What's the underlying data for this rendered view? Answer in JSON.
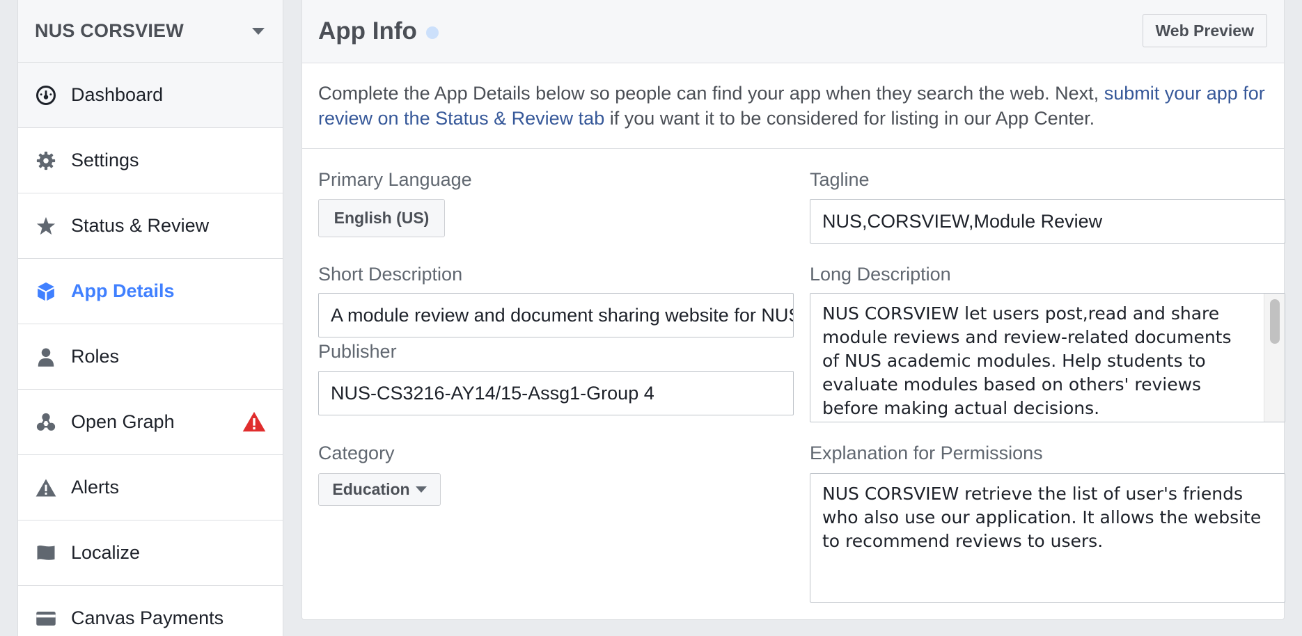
{
  "sidebar": {
    "app_name": "NUS CORSVIEW",
    "items": [
      {
        "label": "Dashboard",
        "icon": "dashboard-icon"
      },
      {
        "label": "Settings",
        "icon": "gear-icon"
      },
      {
        "label": "Status & Review",
        "icon": "star-icon"
      },
      {
        "label": "App Details",
        "icon": "cube-icon",
        "active": true
      },
      {
        "label": "Roles",
        "icon": "person-icon"
      },
      {
        "label": "Open Graph",
        "icon": "graph-nodes-icon",
        "badge": "warning-icon"
      },
      {
        "label": "Alerts",
        "icon": "alert-triangle-icon"
      },
      {
        "label": "Localize",
        "icon": "flag-icon"
      },
      {
        "label": "Canvas Payments",
        "icon": "credit-card-icon"
      }
    ]
  },
  "header": {
    "title": "App Info",
    "web_preview_label": "Web Preview"
  },
  "intro": {
    "text_before": "Complete the App Details below so people can find your app when they search the web. Next, ",
    "link_text": "submit your app for review on the Status & Review tab",
    "text_after": " if you want it to be considered for listing in our App Center."
  },
  "form": {
    "primary_language": {
      "label": "Primary Language",
      "value": "English (US)"
    },
    "tagline": {
      "label": "Tagline",
      "value": "NUS,CORSVIEW,Module Review"
    },
    "short_description": {
      "label": "Short Description",
      "value": "A module review and document sharing website for NUS students"
    },
    "long_description": {
      "label": "Long Description",
      "value": "NUS CORSVIEW let users post,read and share module reviews and review-related documents of NUS academic modules. Help students to evaluate modules based on others' reviews before making actual decisions."
    },
    "publisher": {
      "label": "Publisher",
      "value": "NUS-CS3216-AY14/15-Assg1-Group 4"
    },
    "category": {
      "label": "Category",
      "value": "Education"
    },
    "explanation": {
      "label": "Explanation for Permissions",
      "value": "NUS CORSVIEW retrieve the list of user's friends who also use our application. It allows the website to recommend reviews to users."
    }
  },
  "colors": {
    "accent": "#4080ff",
    "link": "#365899",
    "warning": "#e02d2d",
    "icon_gray": "#606770",
    "info_dot": "#cce0fb"
  }
}
